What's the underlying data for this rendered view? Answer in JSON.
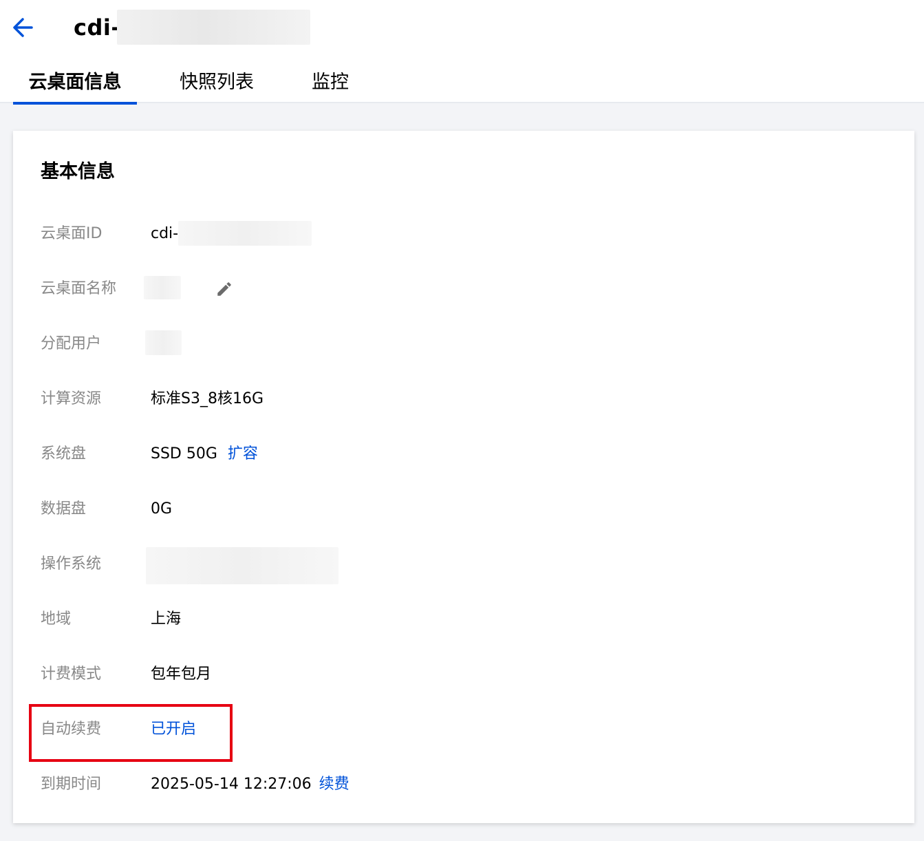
{
  "header": {
    "title": "cdi-",
    "back_icon": "arrow-left-icon",
    "accent_color": "#0052d9"
  },
  "tabs": [
    {
      "label": "云桌面信息",
      "active": true
    },
    {
      "label": "快照列表",
      "active": false
    },
    {
      "label": "监控",
      "active": false
    }
  ],
  "card": {
    "title": "基本信息",
    "rows": {
      "desktop_id": {
        "label": "云桌面ID",
        "value": "cdi-"
      },
      "desktop_name": {
        "label": "云桌面名称",
        "value": "",
        "icon": "pencil-edit-icon"
      },
      "assigned_user": {
        "label": "分配用户",
        "value": ""
      },
      "compute": {
        "label": "计算资源",
        "value": "标准S3_8核16G"
      },
      "system_disk": {
        "label": "系统盘",
        "value": "SSD 50G",
        "action": "扩容"
      },
      "data_disk": {
        "label": "数据盘",
        "value": "0G"
      },
      "os": {
        "label": "操作系统",
        "value": ""
      },
      "region": {
        "label": "地域",
        "value": "上海"
      },
      "billing": {
        "label": "计费模式",
        "value": "包年包月"
      },
      "auto_renew": {
        "label": "自动续费",
        "value": "已开启"
      },
      "expiry": {
        "label": "到期时间",
        "value": "2025-05-14 12:27:06",
        "action": "续费"
      }
    }
  },
  "highlight_color": "#e60012"
}
